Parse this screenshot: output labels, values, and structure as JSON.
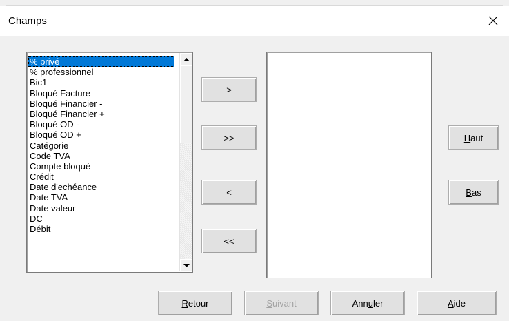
{
  "window": {
    "title": "Champs"
  },
  "fields_list": {
    "items": [
      "% privé",
      "% professionnel",
      "Bic1",
      "Bloqué Facture",
      "Bloqué Financier -",
      "Bloqué Financier +",
      "Bloqué OD -",
      "Bloqué OD +",
      "Catégorie",
      "Code TVA",
      "Compte bloqué",
      "Crédit",
      "Date d'echéance",
      "Date TVA",
      "Date valeur",
      "DC",
      "Débit"
    ],
    "selected_index": 0
  },
  "transfer": {
    "add_one": ">",
    "add_all": ">>",
    "remove_one": "<",
    "remove_all": "<<"
  },
  "order": {
    "up": "Haut",
    "down": "Bas"
  },
  "footer": {
    "back": "Retour",
    "next": "Suivant",
    "cancel": "Annuler",
    "help": "Aide"
  }
}
